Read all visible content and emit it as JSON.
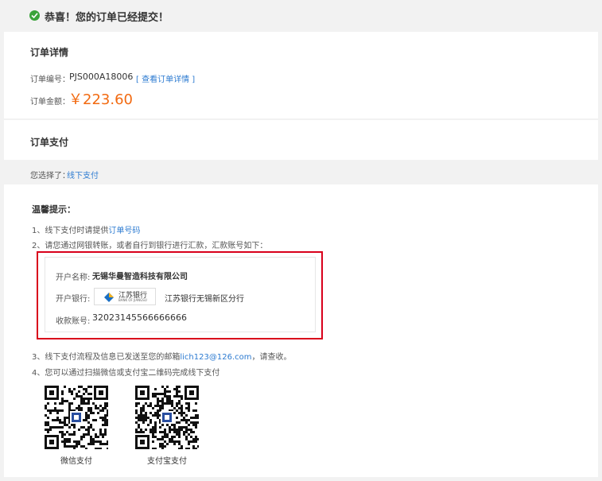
{
  "header": {
    "title": "恭喜！您的订单已经提交！",
    "icon": "check-circle-icon",
    "icon_color": "#3aa33a"
  },
  "order": {
    "section_title": "订单详情",
    "number_label": "订单编号：",
    "number_value": "PJS000A18006",
    "view_link": "[ 查看订单详情 ]",
    "amount_label": "订单金额：",
    "amount_value": "￥223.60",
    "amount_color": "#f26a11"
  },
  "payment": {
    "section_title": "订单支付",
    "chosen_label": "您选择了：",
    "chosen_value": "线下支付"
  },
  "tips": {
    "title": "温馨提示：",
    "item1_prefix": "1、线下支付时请提供",
    "item1_link": "订单号码",
    "item2": "2、请您通过网银转账，或者自行到银行进行汇款，汇款账号如下：",
    "item3_prefix": "3、线下支付流程及信息已发送至您的邮箱",
    "item3_email": "lich123@126.com",
    "item3_suffix": "，请查收。",
    "item4": "4、您可以通过扫描微信或支付宝二维码完成线下支付"
  },
  "bank": {
    "account_name_label": "开户名称:",
    "account_name_value": "无锡华曼智造科技有限公司",
    "bank_label": "开户银行:",
    "bank_logo_text": "江苏银行",
    "bank_logo_subtext": "BANK OF JIANGSU",
    "bank_value": "江苏银行无锡新区分行",
    "account_no_label": "收款账号:",
    "account_no_value": "32023145566666666",
    "highlight_color": "#d9001b"
  },
  "qr": {
    "wechat_label": "微信支付",
    "alipay_label": "支付宝支付"
  }
}
